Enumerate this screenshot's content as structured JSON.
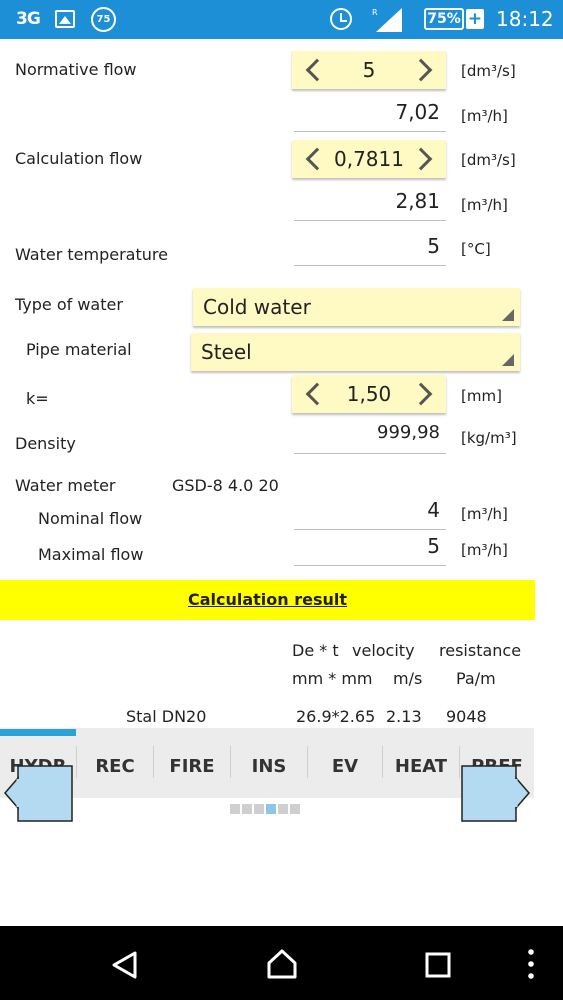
{
  "status_bar": {
    "network": "3G",
    "notification_badge": "75",
    "battery_level": "75%",
    "charging": "+",
    "roaming": "R",
    "time": "18:12",
    "icons": [
      "image-icon",
      "alarm-icon",
      "signal-icon",
      "battery-icon"
    ]
  },
  "normative_flow": {
    "label": "Normative flow",
    "value": "5",
    "unit": "[dm³/s]",
    "converted": "7,02",
    "converted_unit": "[m³/h]"
  },
  "calculation_flow": {
    "label": "Calculation flow",
    "value": "0,7811",
    "unit": "[dm³/s]",
    "converted": "2,81",
    "converted_unit": "[m³/h]"
  },
  "water_temperature": {
    "label": "Water temperature",
    "value": "5",
    "unit": "[°C]"
  },
  "type_of_water": {
    "label": "Type of water",
    "selected": "Cold water"
  },
  "pipe_material": {
    "label": "Pipe material",
    "selected": "Steel"
  },
  "roughness": {
    "label": "k=",
    "value": "1,50",
    "unit": "[mm]"
  },
  "density": {
    "label": "Density",
    "value": "999,98",
    "unit": "[kg/m³]"
  },
  "water_meter": {
    "label": "Water meter",
    "model": "GSD-8 4.0 20",
    "nominal_flow": {
      "label": "Nominal flow",
      "value": "4",
      "unit": "[m³/h]"
    },
    "maximal_flow": {
      "label": "Maximal flow",
      "value": "5",
      "unit": "[m³/h]"
    }
  },
  "result": {
    "title": "Calculation result",
    "headers": [
      "De * t",
      "velocity",
      "resistance"
    ],
    "units": [
      "mm * mm",
      "m/s",
      "Pa/m"
    ],
    "rows": [
      {
        "name": "Stal DN20",
        "de_t": "26.9*2.65",
        "velocity": "2.13",
        "resistance": "9048"
      }
    ]
  },
  "tabs": [
    "HYDR",
    "REC",
    "FIRE",
    "INS",
    "EV",
    "HEAT",
    "PREF"
  ],
  "active_tab": "HYDR",
  "pager": {
    "pages": 6,
    "current": 4
  },
  "colors": {
    "status_bar": "#1c8fd6",
    "input_yellow": "#fff9c4",
    "result_yellow": "#ffff00",
    "tab_indicator": "#29a3d8",
    "nav_arrow": "#b3daf0"
  }
}
